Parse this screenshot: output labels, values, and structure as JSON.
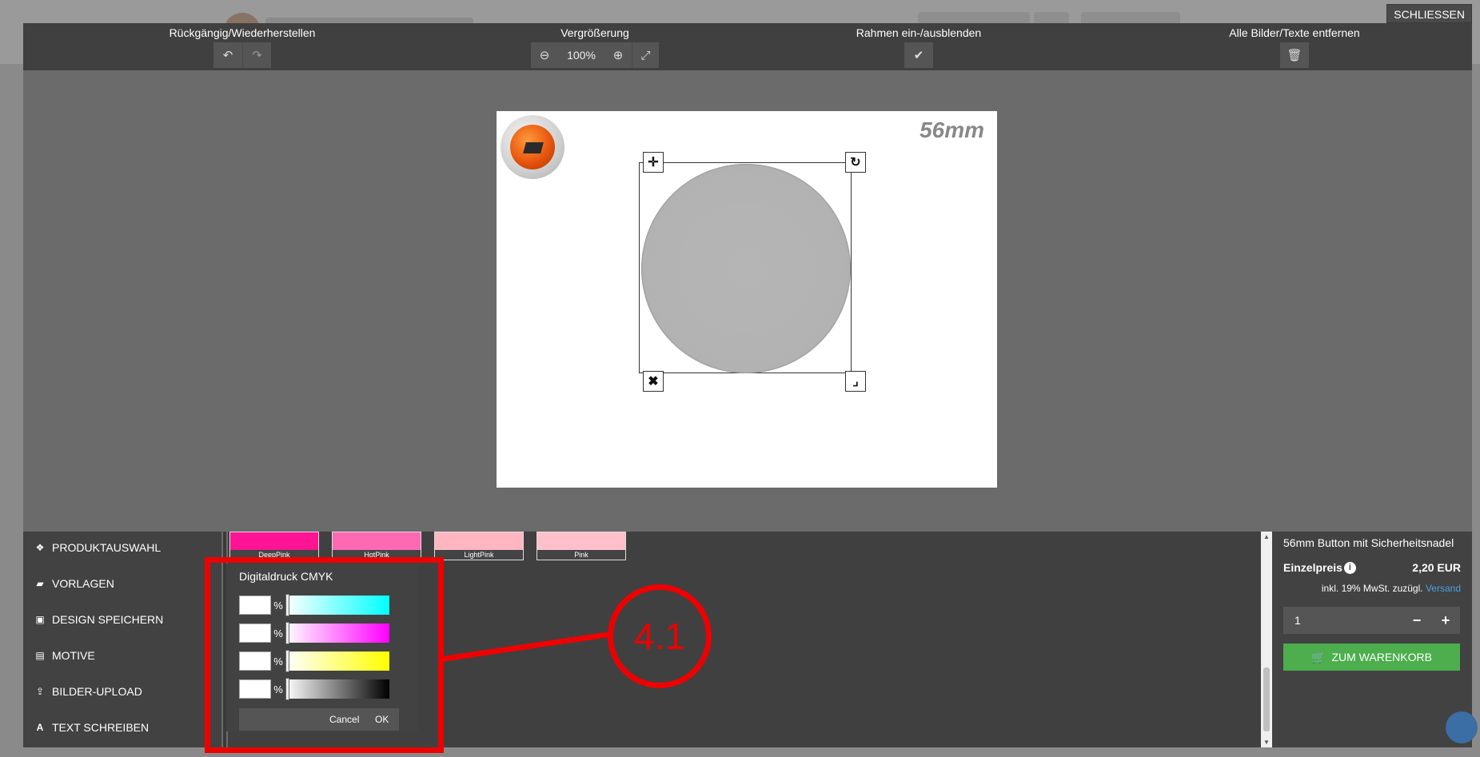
{
  "site": {
    "close_label": "SCHLIESSEN"
  },
  "toolbar": {
    "undo_redo_label": "Rückgängig/Wiederherstellen",
    "zoom_label": "Vergrößerung",
    "zoom_value": "100%",
    "frame_label": "Rahmen ein-/ausblenden",
    "remove_all_label": "Alle Bilder/Texte entfernen"
  },
  "canvas": {
    "size_label": "56mm"
  },
  "menu": {
    "items": [
      {
        "label": "PRODUKTAUSWAHL",
        "icon": "cubes-icon"
      },
      {
        "label": "VORLAGEN",
        "icon": "folder-icon"
      },
      {
        "label": "DESIGN SPEICHERN",
        "icon": "save-icon"
      },
      {
        "label": "MOTIVE",
        "icon": "image-icon"
      },
      {
        "label": "BILDER-UPLOAD",
        "icon": "upload-icon"
      },
      {
        "label": "TEXT SCHREIBEN",
        "icon": "font-icon"
      }
    ]
  },
  "swatches": [
    {
      "name": "DeepPink",
      "color": "#ff1493"
    },
    {
      "name": "HotPink",
      "color": "#ff69b4"
    },
    {
      "name": "LightPink",
      "color": "#ffb6c1"
    },
    {
      "name": "Pink",
      "color": "#ffc0cb"
    }
  ],
  "cmyk": {
    "title": "Digitaldruck CMYK",
    "percent": "%",
    "cancel_label": "Cancel",
    "ok_label": "OK",
    "channels": [
      {
        "name": "cyan",
        "color": "#00ffff"
      },
      {
        "name": "magenta",
        "color": "#ff00ff"
      },
      {
        "name": "yellow",
        "color": "#ffff00"
      },
      {
        "name": "black",
        "color": "#000000"
      }
    ]
  },
  "annotation": {
    "label": "4.1",
    "color": "#ee0000"
  },
  "product": {
    "title": "56mm Button mit Sicherheitsnadel",
    "unit_price_label": "Einzelpreis",
    "unit_price": "2,20 EUR",
    "tax_text": "inkl. 19% MwSt. zuzügl.",
    "shipping_link": "Versand",
    "quantity": "1",
    "minus": "−",
    "plus": "+",
    "cart_label": "ZUM WARENKORB"
  }
}
